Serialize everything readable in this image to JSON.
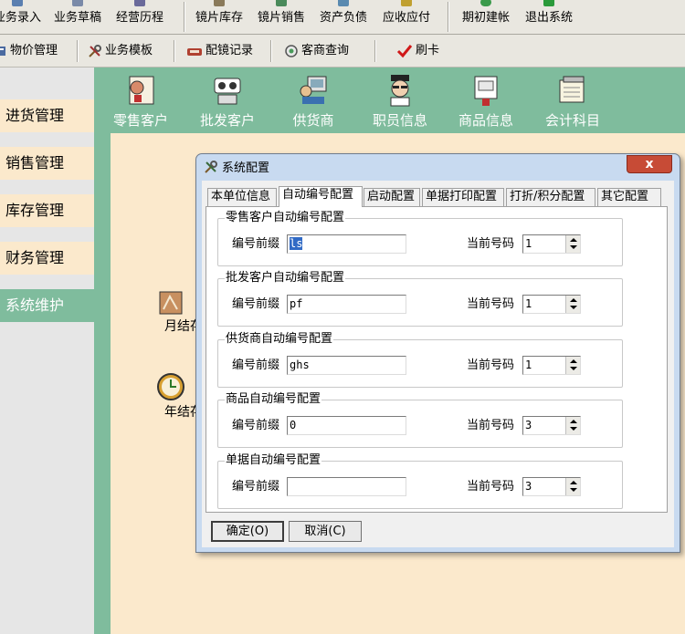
{
  "toolbar": {
    "items": [
      "业务录入",
      "业务草稿",
      "经营历程",
      "镜片库存",
      "镜片销售",
      "资产负债",
      "应收应付",
      "期初建帐",
      "退出系统"
    ]
  },
  "toolbar2": {
    "items": [
      "物价管理",
      "业务模板",
      "配镜记录",
      "客商查询",
      "刷卡"
    ]
  },
  "leftnav": {
    "items": [
      "进货管理",
      "销售管理",
      "库存管理",
      "财务管理",
      "系统维护"
    ]
  },
  "iconbar": {
    "items": [
      "零售客户",
      "批发客户",
      "供货商",
      "职员信息",
      "商品信息",
      "会计科目"
    ]
  },
  "workspace": {
    "items": [
      "月结存",
      "年结存"
    ]
  },
  "dialog": {
    "title": "系统配置",
    "close_label": "x",
    "tabs": [
      "本单位信息",
      "自动编号配置",
      "启动配置",
      "单据打印配置",
      "打折/积分配置",
      "其它配置"
    ],
    "prefix_label": "编号前缀",
    "current_label": "当前号码",
    "groups": [
      {
        "title": "零售客户自动编号配置",
        "prefix": "ls",
        "current": "1"
      },
      {
        "title": "批发客户自动编号配置",
        "prefix": "pf",
        "current": "1"
      },
      {
        "title": "供货商自动编号配置",
        "prefix": "ghs",
        "current": "1"
      },
      {
        "title": "商品自动编号配置",
        "prefix": "0",
        "current": "3"
      },
      {
        "title": "单据自动编号配置",
        "prefix": "",
        "current": "3"
      }
    ],
    "ok_label": "确定(O)",
    "cancel_label": "取消(C)"
  },
  "colors": {
    "accent_green": "#7fbc9d",
    "panel_cream": "#fbe9cc",
    "close_red": "#c74b36"
  }
}
